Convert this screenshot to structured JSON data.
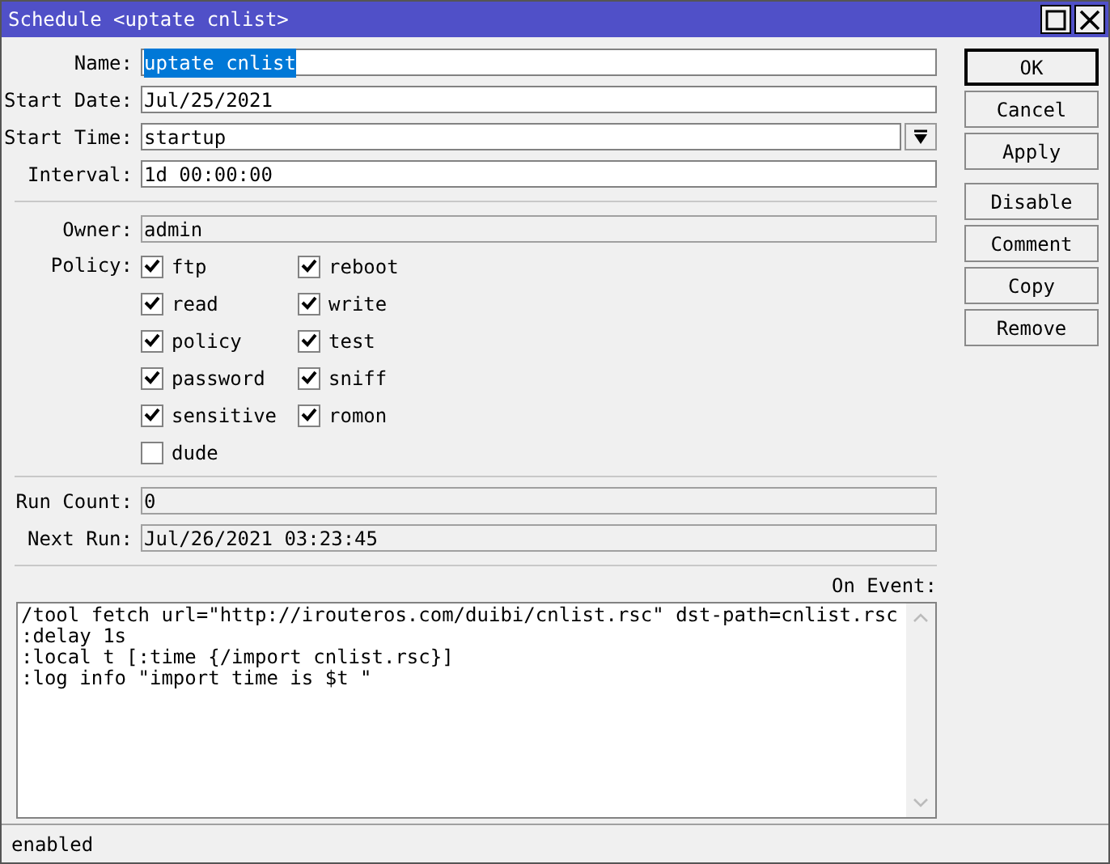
{
  "window": {
    "title": "Schedule <uptate cnlist>"
  },
  "fields": [
    {
      "label": "Name:",
      "value": "uptate cnlist",
      "selected": true
    },
    {
      "label": "Start Date:",
      "value": "Jul/25/2021",
      "selected": false
    },
    {
      "label": "Start Time:",
      "value": "startup",
      "selected": false,
      "kind": "dropdown"
    },
    {
      "label": "Interval:",
      "value": "1d 00:00:00",
      "selected": false
    }
  ],
  "owner": {
    "label": "Owner:",
    "value": "admin"
  },
  "policy": {
    "label": "Policy:",
    "items": [
      {
        "label": "ftp",
        "checked": true
      },
      {
        "label": "reboot",
        "checked": true
      },
      {
        "label": "read",
        "checked": true
      },
      {
        "label": "write",
        "checked": true
      },
      {
        "label": "policy",
        "checked": true
      },
      {
        "label": "test",
        "checked": true
      },
      {
        "label": "password",
        "checked": true
      },
      {
        "label": "sniff",
        "checked": true
      },
      {
        "label": "sensitive",
        "checked": true
      },
      {
        "label": "romon",
        "checked": true
      },
      {
        "label": "dude",
        "checked": false
      }
    ]
  },
  "readonly_fields": [
    {
      "label": "Run Count:",
      "value": "0"
    },
    {
      "label": "Next Run:",
      "value": "Jul/26/2021 03:23:45"
    }
  ],
  "on_event": {
    "label": "On Event:",
    "lines": [
      "/tool fetch url=\"http://irouteros.com/duibi/cnlist.rsc\" dst-path=cnlist.rsc",
      ":delay 1s",
      ":local t [:time {/import cnlist.rsc}]",
      ":log info \"import time is $t \""
    ]
  },
  "buttons": [
    {
      "label": "OK",
      "kind": "default"
    },
    {
      "label": "Cancel",
      "kind": "normal"
    },
    {
      "label": "Apply",
      "kind": "normal"
    },
    {
      "label": "Disable",
      "kind": "gap"
    },
    {
      "label": "Comment",
      "kind": "normal"
    },
    {
      "label": "Copy",
      "kind": "normal"
    },
    {
      "label": "Remove",
      "kind": "normal"
    }
  ],
  "status_bar": "enabled"
}
